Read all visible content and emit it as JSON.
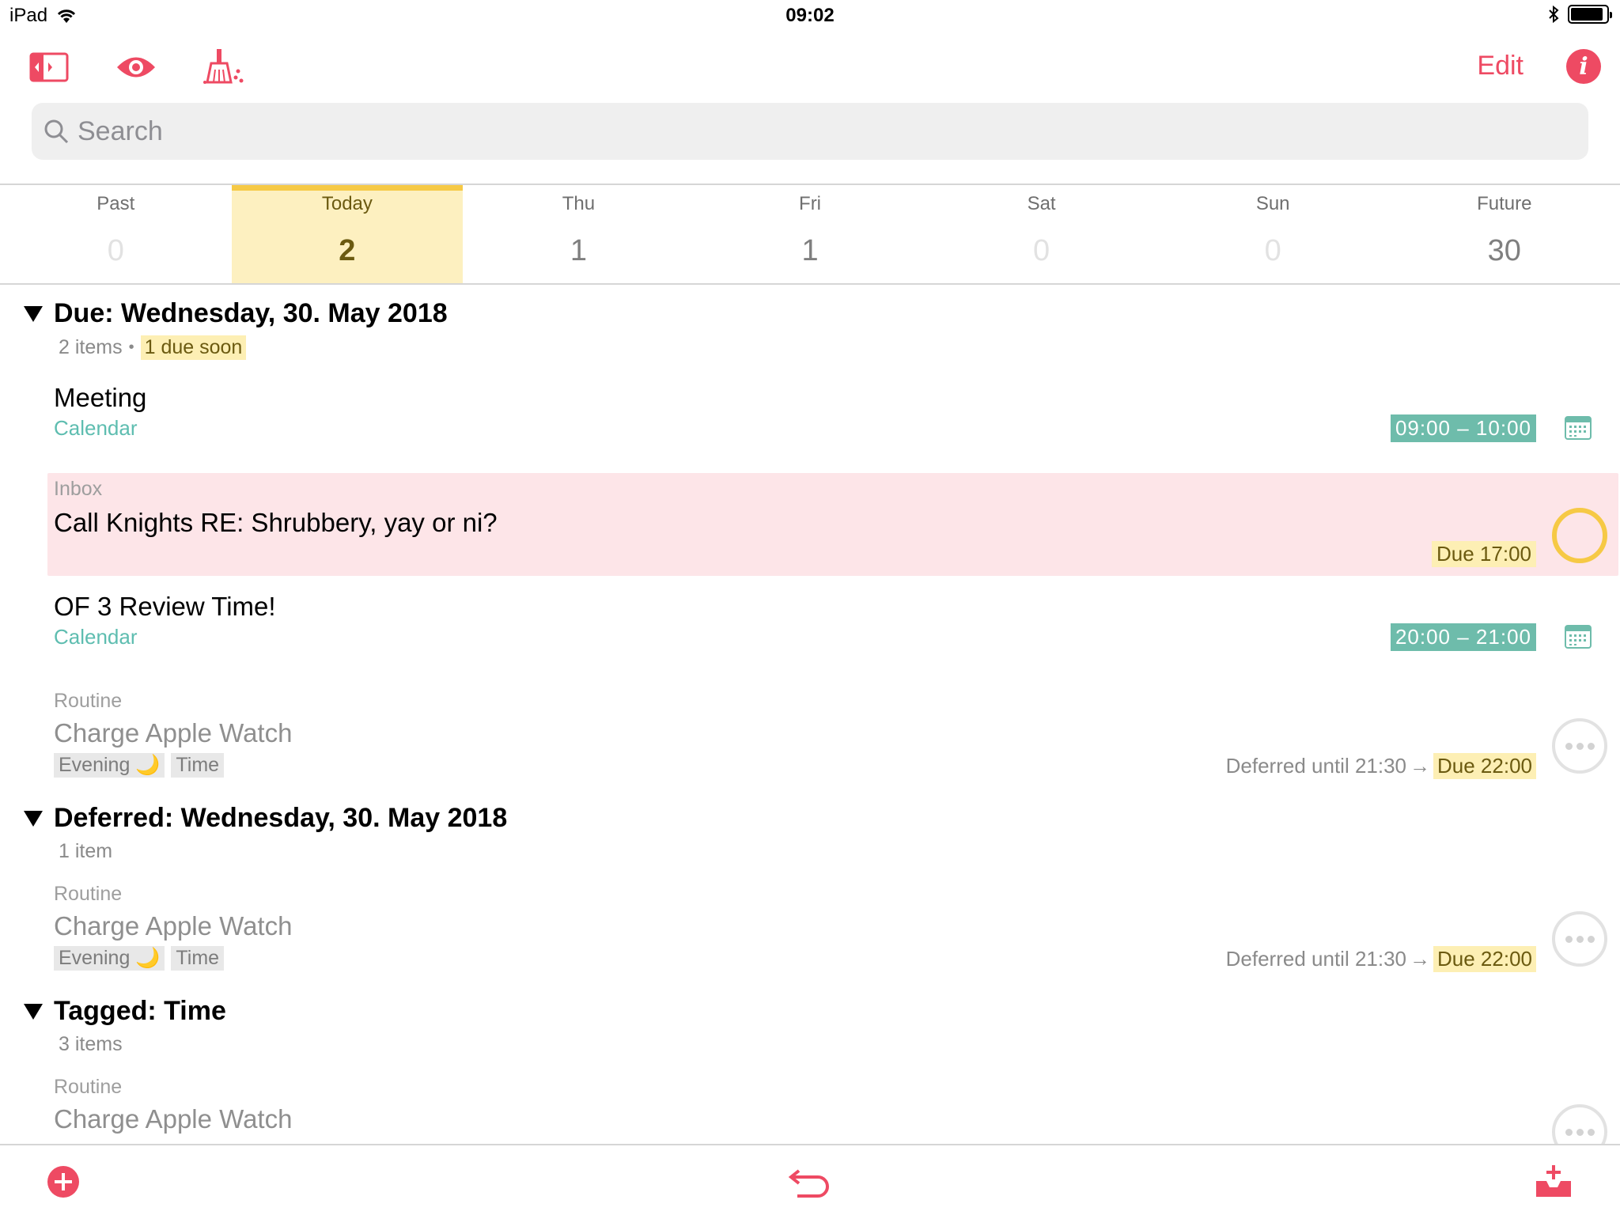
{
  "status": {
    "device": "iPad",
    "time": "09:02"
  },
  "toolbar": {
    "edit_label": "Edit",
    "info_label": "i",
    "accent": "#ee4a63"
  },
  "search": {
    "placeholder": "Search",
    "value": ""
  },
  "days": [
    {
      "name": "Past",
      "count": "0"
    },
    {
      "name": "Today",
      "count": "2"
    },
    {
      "name": "Thu",
      "count": "1"
    },
    {
      "name": "Fri",
      "count": "1"
    },
    {
      "name": "Sat",
      "count": "0"
    },
    {
      "name": "Sun",
      "count": "0"
    },
    {
      "name": "Future",
      "count": "30"
    }
  ],
  "sections": {
    "due": {
      "title": "Due: Wednesday, 30. May 2018",
      "count": "2 items",
      "due_soon": "1 due soon",
      "items": {
        "meeting": {
          "title": "Meeting",
          "subtitle": "Calendar",
          "time": "09:00 – 10:00",
          "icon": "calendar-icon"
        },
        "knights": {
          "context": "Inbox",
          "title": "Call Knights RE: Shrubbery, yay or ni?",
          "due": "Due 17:00"
        },
        "review": {
          "title": "OF 3 Review Time!",
          "subtitle": "Calendar",
          "time": "20:00 – 21:00",
          "icon": "calendar-icon"
        },
        "watch": {
          "context": "Routine",
          "title": "Charge Apple Watch",
          "tags": [
            "Evening 🌙",
            "Time"
          ],
          "deferred": "Deferred until 21:30",
          "arrow": "→",
          "due": "Due 22:00"
        }
      }
    },
    "deferred": {
      "title": "Deferred: Wednesday, 30. May 2018",
      "count": "1 item",
      "items": {
        "watch": {
          "context": "Routine",
          "title": "Charge Apple Watch",
          "tags": [
            "Evening 🌙",
            "Time"
          ],
          "deferred": "Deferred until 21:30",
          "arrow": "→",
          "due": "Due 22:00"
        }
      }
    },
    "tagged": {
      "title": "Tagged: Time",
      "count": "3 items",
      "items": {
        "watch": {
          "context": "Routine",
          "title": "Charge Apple Watch"
        }
      }
    }
  },
  "bottombar": {
    "add": "add-icon",
    "undo": "undo-icon",
    "inbox": "inbox-add-icon"
  }
}
